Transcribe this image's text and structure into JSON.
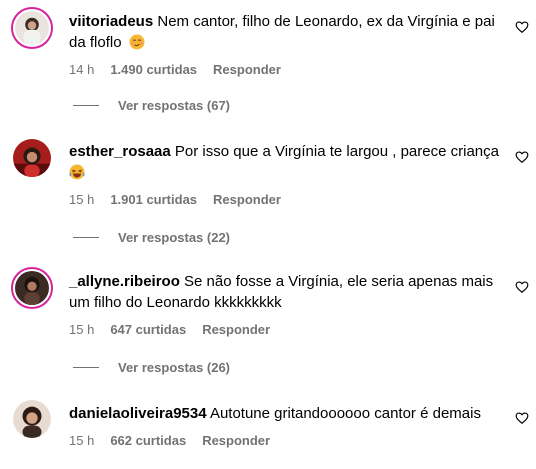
{
  "comments": [
    {
      "username": "viitoriadeus",
      "text": "Nem cantor, filho de Leonardo, ex da Virgínia e pai da floflo",
      "emoji": "smirk-face-emoji",
      "time": "14 h",
      "likes": "1.490 curtidas",
      "reply_label": "Responder",
      "view_replies": "Ver respostas (67)"
    },
    {
      "username": "esther_rosaaa",
      "text": "Por isso que a Virgínia te largou , parece criança",
      "emoji": "laughing-face-emoji",
      "time": "15 h",
      "likes": "1.901 curtidas",
      "reply_label": "Responder",
      "view_replies": "Ver respostas (22)"
    },
    {
      "username": "_allyne.ribeiroo",
      "text": "Se não fosse a Virgínia, ele seria apenas mais um filho do Leonardo kkkkkkkkk",
      "time": "15 h",
      "likes": "647 curtidas",
      "reply_label": "Responder",
      "view_replies": "Ver respostas (26)"
    },
    {
      "username": "danielaoliveira9534",
      "text": "Autotune gritandoooooo cantor é demais",
      "time": "15 h",
      "likes": "662 curtidas",
      "reply_label": "Responder"
    }
  ],
  "colors": {
    "text": "#000000",
    "meta": "#737373",
    "story_ring": "#d6249f"
  },
  "icons": {
    "like": "heart-outline-icon"
  }
}
